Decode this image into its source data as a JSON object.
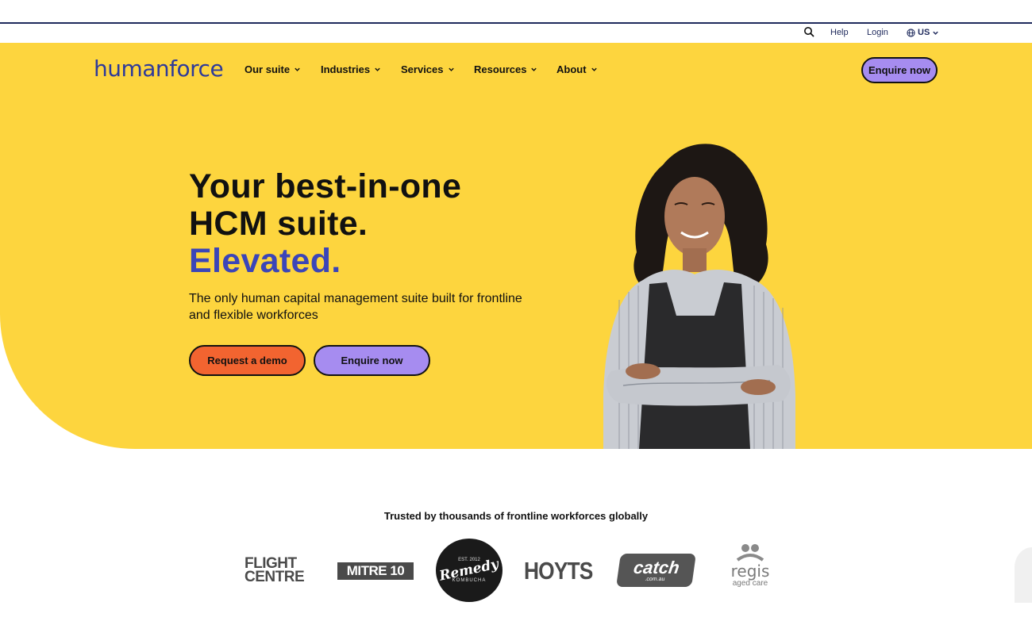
{
  "utility": {
    "search_icon": "search-icon",
    "help": "Help",
    "login": "Login",
    "region": "US",
    "region_icon": "globe-icon"
  },
  "nav": {
    "logo": "humanforce",
    "items": [
      {
        "label": "Our suite"
      },
      {
        "label": "Industries"
      },
      {
        "label": "Services"
      },
      {
        "label": "Resources"
      },
      {
        "label": "About"
      }
    ],
    "enquire": "Enquire now"
  },
  "hero": {
    "line1": "Your best-in-one",
    "line2": "HCM suite.",
    "line3": "Elevated.",
    "subline": "The only human capital management suite built for frontline and flexible workforces",
    "cta_demo": "Request a demo",
    "cta_enquire": "Enquire now"
  },
  "trusted": {
    "heading": "Trusted by thousands of frontline workforces globally",
    "logos": [
      {
        "name": "Flight Centre",
        "text1": "FLIGHT",
        "text2": "CENTRE"
      },
      {
        "name": "Mitre 10",
        "text": "MITRE 10"
      },
      {
        "name": "Remedy Kombucha",
        "text": "Remedy",
        "sub": "KOMBUCHA",
        "top": "EST. 2012"
      },
      {
        "name": "Hoyts",
        "text": "HOYTS"
      },
      {
        "name": "Catch",
        "text": "catch",
        "sub": ".com.au"
      },
      {
        "name": "Regis",
        "text": "regis",
        "sub": "aged care"
      }
    ]
  },
  "colors": {
    "hero_yellow": "#fdd53e",
    "accent_blue": "#3b45b8",
    "button_purple": "#a68cf0",
    "button_orange": "#f26430",
    "navy": "#1f2a5c"
  }
}
